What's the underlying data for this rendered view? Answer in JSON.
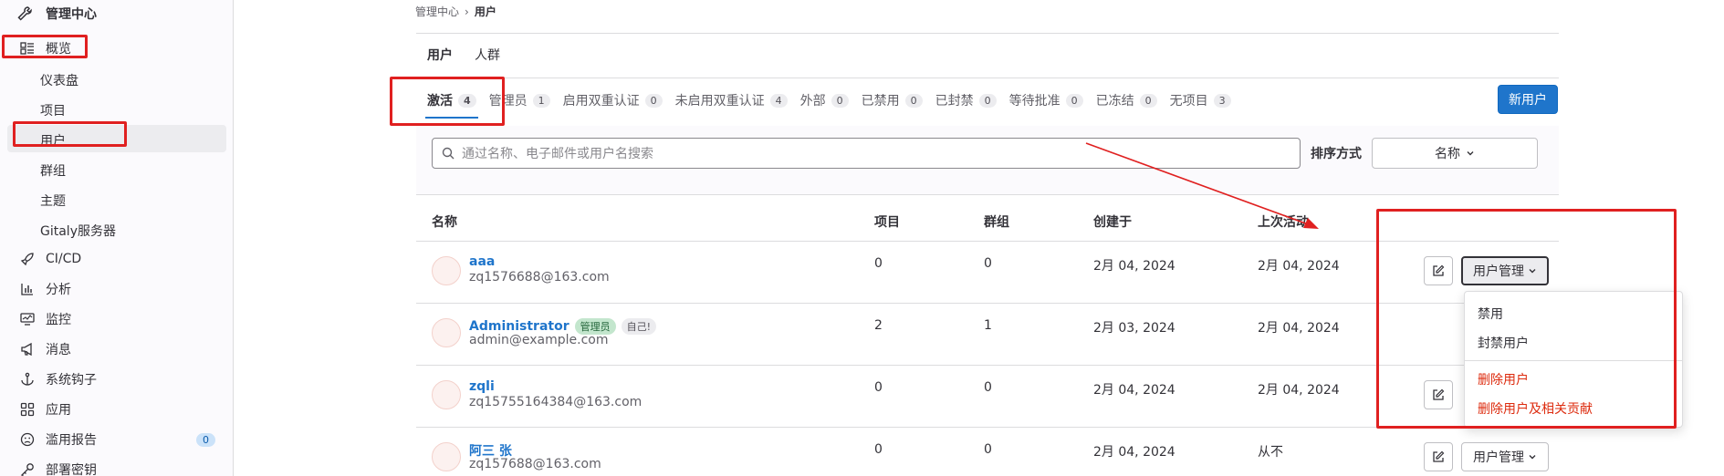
{
  "sidebar": {
    "title": "管理中心",
    "overview": "概览",
    "sub_items": [
      "仪表盘",
      "项目",
      "用户",
      "群组",
      "主题",
      "Gitaly服务器"
    ],
    "items": [
      {
        "label": "CI/CD",
        "icon": "rocket-icon"
      },
      {
        "label": "分析",
        "icon": "chart-icon"
      },
      {
        "label": "监控",
        "icon": "monitor-icon"
      },
      {
        "label": "消息",
        "icon": "bullhorn-icon"
      },
      {
        "label": "系统钩子",
        "icon": "anchor-icon"
      },
      {
        "label": "应用",
        "icon": "apps-icon"
      },
      {
        "label": "滥用报告",
        "icon": "abuse-icon",
        "badge": "0"
      },
      {
        "label": "部署密钥",
        "icon": "key-icon"
      }
    ]
  },
  "breadcrumb": {
    "root": "管理中心",
    "current": "用户"
  },
  "subnav": {
    "users": "用户",
    "cohorts": "人群"
  },
  "tabs": [
    {
      "label": "激活",
      "count": "4"
    },
    {
      "label": "管理员",
      "count": "1"
    },
    {
      "label": "启用双重认证",
      "count": "0"
    },
    {
      "label": "未启用双重认证",
      "count": "4"
    },
    {
      "label": "外部",
      "count": "0"
    },
    {
      "label": "已禁用",
      "count": "0"
    },
    {
      "label": "已封禁",
      "count": "0"
    },
    {
      "label": "等待批准",
      "count": "0"
    },
    {
      "label": "已冻结",
      "count": "0"
    },
    {
      "label": "无项目",
      "count": "3"
    }
  ],
  "new_user_button": "新用户",
  "search": {
    "placeholder": "通过名称、电子邮件或用户名搜索"
  },
  "sort": {
    "label": "排序方式",
    "value": "名称"
  },
  "table": {
    "headers": [
      "名称",
      "项目",
      "群组",
      "创建于",
      "上次活动"
    ],
    "rows": [
      {
        "name": "aaa",
        "email": "zq1576688@163.com",
        "projects": "0",
        "groups": "0",
        "created": "2月 04, 2024",
        "last": "2月 04, 2024"
      },
      {
        "name": "Administrator",
        "email": "admin@example.com",
        "badge_admin": "管理员",
        "badge_self": "自己!",
        "projects": "2",
        "groups": "1",
        "created": "2月 03, 2024",
        "last": "2月 04, 2024"
      },
      {
        "name": "zqli",
        "email": "zq15755164384@163.com",
        "projects": "0",
        "groups": "0",
        "created": "2月 04, 2024",
        "last": "2月 04, 2024"
      },
      {
        "name": "阿三 张",
        "email": "zq157688@163.com",
        "projects": "0",
        "groups": "0",
        "created": "2月 04, 2024",
        "last": "从不"
      }
    ]
  },
  "user_admin_button": "用户管理",
  "dropdown": {
    "block": "禁用",
    "ban": "封禁用户",
    "delete": "删除用户",
    "delete_contrib": "删除用户及相关贡献"
  },
  "colors": {
    "accent": "#1f75cb",
    "annotation": "#e02020",
    "danger": "#dd2b0e"
  }
}
